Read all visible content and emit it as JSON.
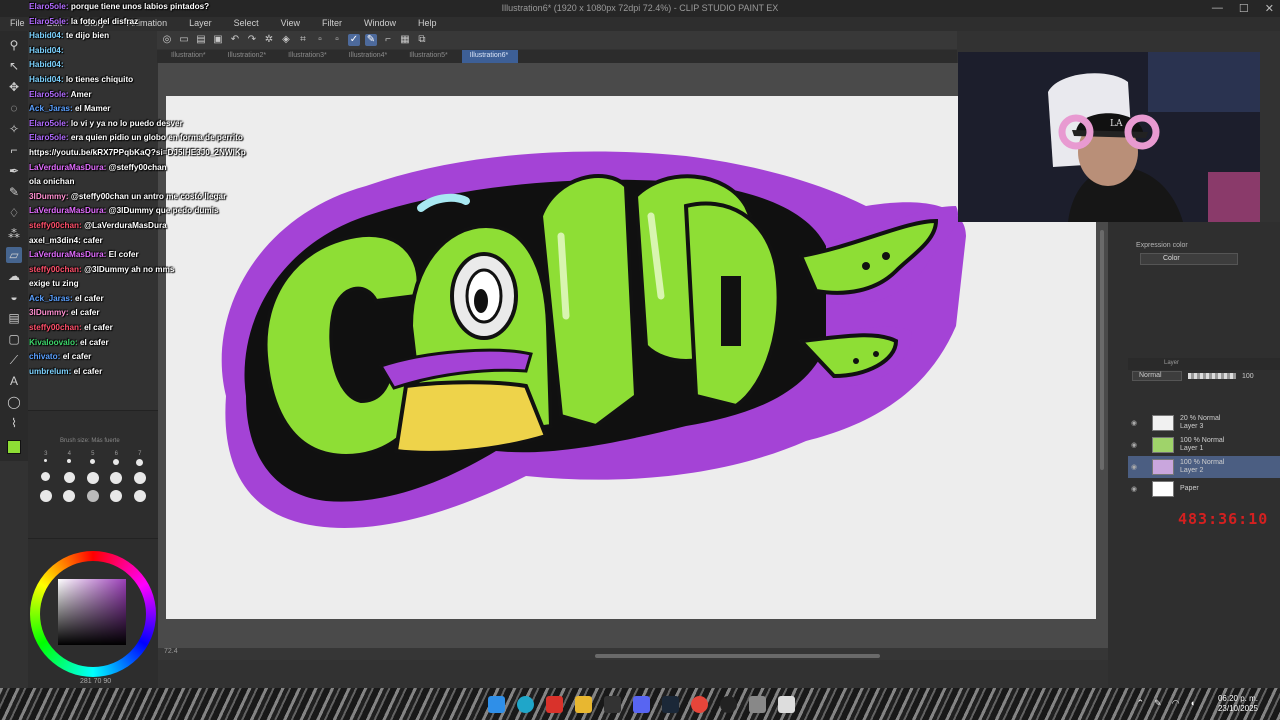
{
  "window": {
    "title": "Illustration6* (1920 x 1080px 72dpi 72.4%) - CLIP STUDIO PAINT EX",
    "controls": [
      "—",
      "☐",
      "✕"
    ]
  },
  "menu": [
    "File",
    "Edit",
    "Story",
    "Animation",
    "Layer",
    "Select",
    "View",
    "Filter",
    "Window",
    "Help"
  ],
  "tabs": [
    {
      "label": "Illustration*",
      "active": false
    },
    {
      "label": "Illustration2*",
      "active": false
    },
    {
      "label": "Illustration3*",
      "active": false
    },
    {
      "label": "Illustration4*",
      "active": false
    },
    {
      "label": "Illustration5*",
      "active": false
    },
    {
      "label": "Illustration6*",
      "active": true
    }
  ],
  "chat": [
    {
      "user": "Elaro5ole:",
      "msg": "porque tiene unos labios pintados?",
      "color": "#b26bff"
    },
    {
      "user": "Elaro5ole:",
      "msg": "la foto del disfraz",
      "color": "#b26bff"
    },
    {
      "user": "Habid04:",
      "msg": "te dijo bien",
      "color": "#7dd3ff"
    },
    {
      "user": "Habid04:",
      "msg": "",
      "color": "#7dd3ff"
    },
    {
      "user": "Habid04:",
      "msg": "",
      "color": "#7dd3ff"
    },
    {
      "user": "Habid04:",
      "msg": "lo tienes chiquito",
      "color": "#7dd3ff"
    },
    {
      "user": "Elaro5ole:",
      "msg": "Amer",
      "color": "#b26bff"
    },
    {
      "user": "Ack_Jaras:",
      "msg": "el Mamer",
      "color": "#5aa0ff"
    },
    {
      "user": "Elaro5ole:",
      "msg": "lo vi y ya no lo puedo desver",
      "color": "#b26bff"
    },
    {
      "user": "Elaro5ole:",
      "msg": "era quien pidio un globo en forma de perrito",
      "color": "#b26bff"
    },
    {
      "user": "",
      "msg": "https://youtu.be/kRX7PPqbKaQ?si=DJ5IHE3J0_2NWlKp",
      "color": "#ffffff"
    },
    {
      "user": "LaVerduraMasDura:",
      "msg": "@steffy00chan",
      "color": "#e26cff"
    },
    {
      "user": "",
      "msg": "ola onichan",
      "color": "#ffffff"
    },
    {
      "user": "3lDummy:",
      "msg": "@steffy00chan un antro me costó llegar",
      "color": "#ff8fd0"
    },
    {
      "user": "LaVerduraMasDura:",
      "msg": "@3lDummy que pedo dumis",
      "color": "#e26cff"
    },
    {
      "user": "steffy00chan:",
      "msg": "@LaVerduraMasDura",
      "color": "#ff4f6a"
    },
    {
      "user": "axel_m3din4:",
      "msg": "cafer",
      "color": "#ffffff"
    },
    {
      "user": "LaVerduraMasDura:",
      "msg": "El cofer",
      "color": "#e26cff"
    },
    {
      "user": "steffy00chan:",
      "msg": "@3lDummy ah no mms",
      "color": "#ff4f6a"
    },
    {
      "user": "",
      "msg": "exige tu zing",
      "color": "#ffffff"
    },
    {
      "user": "Ack_Jaras:",
      "msg": "el cafer",
      "color": "#5aa0ff"
    },
    {
      "user": "3lDummy:",
      "msg": "el cafer",
      "color": "#ff8fd0"
    },
    {
      "user": "steffy00chan:",
      "msg": "el cafer",
      "color": "#ff4f6a"
    },
    {
      "user": "Kivaloovalo:",
      "msg": "el cafer",
      "color": "#3dd66b"
    },
    {
      "user": "chivato:",
      "msg": "el cafer",
      "color": "#5aa0ff"
    },
    {
      "user": "umbrelum:",
      "msg": "el cafer",
      "color": "#7dd3ff"
    }
  ],
  "subtool": {
    "caption": "Brush size: Más fuerte",
    "sizes": [
      "3",
      "4",
      "5",
      "6",
      "7"
    ]
  },
  "color": {
    "values": "281  70  90",
    "current": "#8ede35"
  },
  "statusbar": {
    "zoom": "72.4"
  },
  "properties": {
    "expression_label": "Expression color",
    "expression_value": "Color"
  },
  "layer_panel": {
    "header": "Layer",
    "blend_mode": "Normal",
    "opacity": "100",
    "layers": [
      {
        "opacity_mode": "20 % Normal",
        "name": "Layer 3",
        "selected": false
      },
      {
        "opacity_mode": "100 % Normal",
        "name": "Layer 1",
        "selected": false
      },
      {
        "opacity_mode": "100 % Normal",
        "name": "Layer 2",
        "selected": true
      },
      {
        "opacity_mode": "",
        "name": "Paper",
        "selected": false
      }
    ]
  },
  "timer": "483:36:10",
  "taskbar": {
    "time": "06:20 p. m.",
    "date": "23/10/2025"
  }
}
